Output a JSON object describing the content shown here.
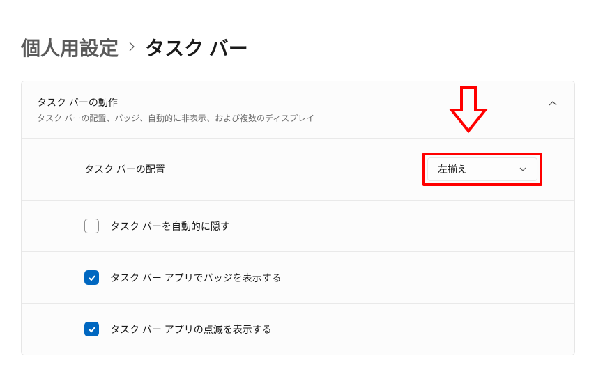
{
  "breadcrumb": {
    "parent": "個人用設定",
    "current": "タスク バー"
  },
  "panel": {
    "title": "タスク バーの動作",
    "subtitle": "タスク バーの配置、バッジ、自動的に非表示、および複数のディスプレイ"
  },
  "alignment": {
    "label": "タスク バーの配置",
    "value": "左揃え"
  },
  "options": {
    "auto_hide": {
      "label": "タスク バーを自動的に隠す",
      "checked": false
    },
    "show_badges": {
      "label": "タスク バー アプリでバッジを表示する",
      "checked": true
    },
    "show_flashing": {
      "label": "タスク バー アプリの点滅を表示する",
      "checked": true
    }
  },
  "colors": {
    "accent": "#0067c0",
    "annotation": "#ff0000"
  }
}
